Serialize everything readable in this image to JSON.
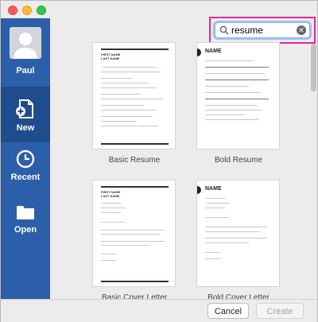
{
  "sidebar": {
    "user": "Paul",
    "items": [
      {
        "label": "New",
        "icon": "new-document-icon"
      },
      {
        "label": "Recent",
        "icon": "clock-icon"
      },
      {
        "label": "Open",
        "icon": "folder-icon"
      }
    ]
  },
  "search": {
    "value": "resume"
  },
  "templates": [
    {
      "name": "Basic Resume"
    },
    {
      "name": "Bold Resume"
    },
    {
      "name": "Basic Cover Letter"
    },
    {
      "name": "Bold Cover Letter"
    }
  ],
  "thumb_text": {
    "first_name": "FIRST NAME",
    "last_name": "LAST NAME",
    "name": "NAME"
  },
  "footer": {
    "cancel": "Cancel",
    "create": "Create"
  },
  "colors": {
    "sidebar": "#2c5fa9",
    "sidebar_selected": "#1f4c8c",
    "highlight": "#e1279c",
    "bold_accent": "#e2a636"
  }
}
